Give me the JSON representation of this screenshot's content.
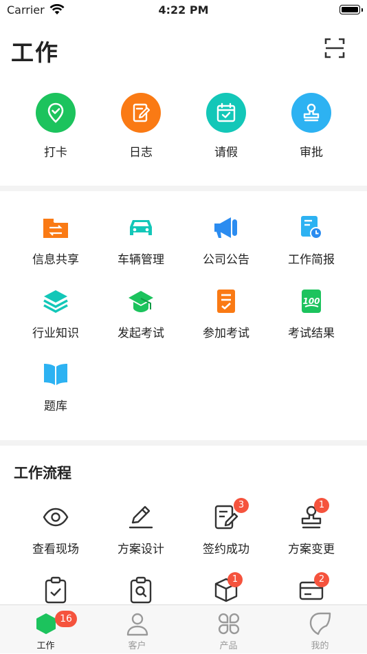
{
  "status": {
    "carrier": "Carrier",
    "time": "4:22 PM"
  },
  "header": {
    "title": "工作"
  },
  "quick": [
    {
      "label": "打卡",
      "color": "#1cc35d",
      "icon": "location-check-icon"
    },
    {
      "label": "日志",
      "color": "#fa7a14",
      "icon": "edit-doc-icon"
    },
    {
      "label": "请假",
      "color": "#13c7b8",
      "icon": "calendar-check-icon"
    },
    {
      "label": "审批",
      "color": "#2db2f2",
      "icon": "stamp-icon"
    }
  ],
  "apps": [
    {
      "label": "信息共享",
      "color": "#fa7a14",
      "icon": "folder-share-icon"
    },
    {
      "label": "车辆管理",
      "color": "#13c7b8",
      "icon": "car-icon"
    },
    {
      "label": "公司公告",
      "color": "#2b8cf0",
      "icon": "megaphone-icon"
    },
    {
      "label": "工作简报",
      "color": "#2db2f2",
      "icon": "report-clock-icon"
    },
    {
      "label": "行业知识",
      "color": "#13c7b8",
      "icon": "layers-icon"
    },
    {
      "label": "发起考试",
      "color": "#1cc35d",
      "icon": "graduation-cap-icon"
    },
    {
      "label": "参加考试",
      "color": "#fa7a14",
      "icon": "checklist-icon"
    },
    {
      "label": "考试结果",
      "color": "#1cc35d",
      "icon": "score-100-icon"
    },
    {
      "label": "题库",
      "color": "#2db2f2",
      "icon": "book-icon"
    }
  ],
  "workflow": {
    "title": "工作流程",
    "items": [
      {
        "label": "查看现场",
        "badge": "",
        "icon": "eye-icon"
      },
      {
        "label": "方案设计",
        "badge": "",
        "icon": "pencil-icon"
      },
      {
        "label": "签约成功",
        "badge": "3",
        "icon": "contract-edit-icon"
      },
      {
        "label": "方案变更",
        "badge": "1",
        "icon": "stamp-outline-icon"
      },
      {
        "label": "",
        "badge": "",
        "icon": "clipboard-check-icon"
      },
      {
        "label": "",
        "badge": "",
        "icon": "clipboard-search-icon"
      },
      {
        "label": "",
        "badge": "1",
        "icon": "box-icon"
      },
      {
        "label": "",
        "badge": "2",
        "icon": "card-icon"
      }
    ]
  },
  "tabs": [
    {
      "label": "工作",
      "badge": "16",
      "icon": "hexagon-icon",
      "active": true
    },
    {
      "label": "客户",
      "badge": "",
      "icon": "person-icon",
      "active": false
    },
    {
      "label": "产品",
      "badge": "",
      "icon": "grid-clover-icon",
      "active": false
    },
    {
      "label": "我的",
      "badge": "",
      "icon": "leaf-icon",
      "active": false
    }
  ]
}
